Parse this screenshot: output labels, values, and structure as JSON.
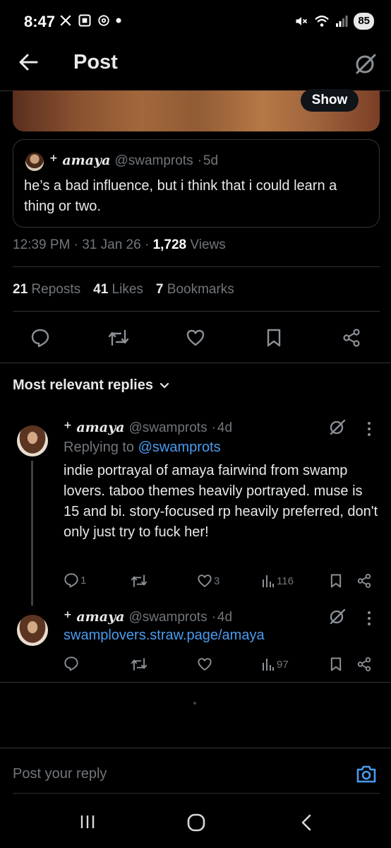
{
  "status_bar": {
    "time": "8:47",
    "battery": "85"
  },
  "header": {
    "title": "Post"
  },
  "media": {
    "show_label": "Show"
  },
  "quoted_post": {
    "display_name": "amaya",
    "handle": "@swamprots",
    "dot": "·",
    "age": "5d",
    "text": "he’s a bad influence, but i think that i could learn a thing or two."
  },
  "post_meta": {
    "time": "12:39 PM",
    "date": "31 Jan 26",
    "views_count": "1,728",
    "views_label": "Views",
    "sep": "·"
  },
  "engagement": {
    "reposts_count": "21",
    "reposts_label": "Reposts",
    "likes_count": "41",
    "likes_label": "Likes",
    "bookmarks_count": "7",
    "bookmarks_label": "Bookmarks"
  },
  "replies_section": {
    "heading": "Most relevant replies"
  },
  "replies": [
    {
      "display_name": "amaya",
      "handle": "@swamprots",
      "dot": "·",
      "age": "4d",
      "replying_to_label": "Replying to",
      "replying_to_handle": "@swamprots",
      "text": "indie portrayal of amaya fairwind from swamp lovers. taboo themes heavily portrayed. muse is 15 and bi. story-focused rp heavily preferred, don't only just try to fuck her!",
      "reply_count": "1",
      "like_count": "3",
      "view_count": "116"
    },
    {
      "display_name": "amaya",
      "handle": "@swamprots",
      "dot": "·",
      "age": "4d",
      "link": "swamplovers.straw.page/amaya",
      "view_count": "97"
    }
  ],
  "composer": {
    "placeholder": "Post your reply"
  },
  "colors": {
    "background": "#000000",
    "text": "#e7e9ea",
    "muted": "#71767b",
    "link": "#4a9bef",
    "divider": "#2f3336"
  }
}
